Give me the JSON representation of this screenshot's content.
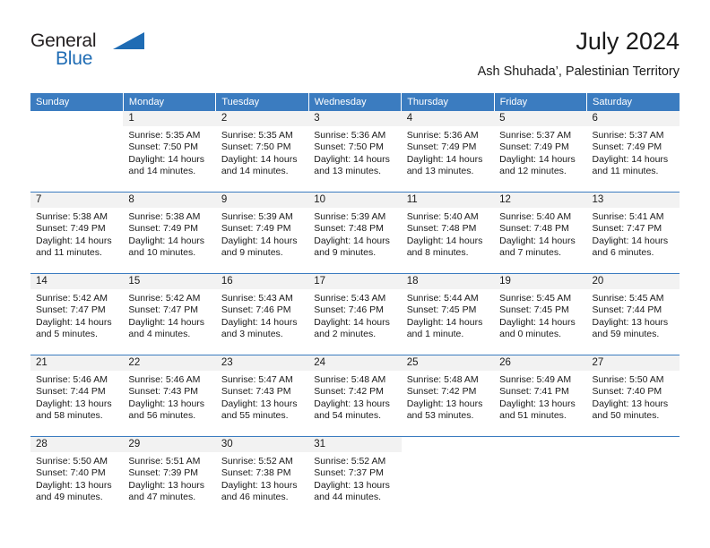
{
  "brand": {
    "name_part1": "General",
    "name_part2": "Blue",
    "triangle_color": "#1f6cb4"
  },
  "header": {
    "title": "July 2024",
    "subtitle": "Ash Shuhada’, Palestinian Territory"
  },
  "theme": {
    "header_blue": "#3b7cc0",
    "daynum_band": "#f2f2f2",
    "text": "#1a1a1a"
  },
  "weekdays": [
    "Sunday",
    "Monday",
    "Tuesday",
    "Wednesday",
    "Thursday",
    "Friday",
    "Saturday"
  ],
  "weeks": [
    [
      {
        "day": "",
        "sunrise": "",
        "sunset": "",
        "daylight1": "",
        "daylight2": "",
        "blank": true
      },
      {
        "day": "1",
        "sunrise": "Sunrise: 5:35 AM",
        "sunset": "Sunset: 7:50 PM",
        "daylight1": "Daylight: 14 hours",
        "daylight2": "and 14 minutes."
      },
      {
        "day": "2",
        "sunrise": "Sunrise: 5:35 AM",
        "sunset": "Sunset: 7:50 PM",
        "daylight1": "Daylight: 14 hours",
        "daylight2": "and 14 minutes."
      },
      {
        "day": "3",
        "sunrise": "Sunrise: 5:36 AM",
        "sunset": "Sunset: 7:50 PM",
        "daylight1": "Daylight: 14 hours",
        "daylight2": "and 13 minutes."
      },
      {
        "day": "4",
        "sunrise": "Sunrise: 5:36 AM",
        "sunset": "Sunset: 7:49 PM",
        "daylight1": "Daylight: 14 hours",
        "daylight2": "and 13 minutes."
      },
      {
        "day": "5",
        "sunrise": "Sunrise: 5:37 AM",
        "sunset": "Sunset: 7:49 PM",
        "daylight1": "Daylight: 14 hours",
        "daylight2": "and 12 minutes."
      },
      {
        "day": "6",
        "sunrise": "Sunrise: 5:37 AM",
        "sunset": "Sunset: 7:49 PM",
        "daylight1": "Daylight: 14 hours",
        "daylight2": "and 11 minutes."
      }
    ],
    [
      {
        "day": "7",
        "sunrise": "Sunrise: 5:38 AM",
        "sunset": "Sunset: 7:49 PM",
        "daylight1": "Daylight: 14 hours",
        "daylight2": "and 11 minutes."
      },
      {
        "day": "8",
        "sunrise": "Sunrise: 5:38 AM",
        "sunset": "Sunset: 7:49 PM",
        "daylight1": "Daylight: 14 hours",
        "daylight2": "and 10 minutes."
      },
      {
        "day": "9",
        "sunrise": "Sunrise: 5:39 AM",
        "sunset": "Sunset: 7:49 PM",
        "daylight1": "Daylight: 14 hours",
        "daylight2": "and 9 minutes."
      },
      {
        "day": "10",
        "sunrise": "Sunrise: 5:39 AM",
        "sunset": "Sunset: 7:48 PM",
        "daylight1": "Daylight: 14 hours",
        "daylight2": "and 9 minutes."
      },
      {
        "day": "11",
        "sunrise": "Sunrise: 5:40 AM",
        "sunset": "Sunset: 7:48 PM",
        "daylight1": "Daylight: 14 hours",
        "daylight2": "and 8 minutes."
      },
      {
        "day": "12",
        "sunrise": "Sunrise: 5:40 AM",
        "sunset": "Sunset: 7:48 PM",
        "daylight1": "Daylight: 14 hours",
        "daylight2": "and 7 minutes."
      },
      {
        "day": "13",
        "sunrise": "Sunrise: 5:41 AM",
        "sunset": "Sunset: 7:47 PM",
        "daylight1": "Daylight: 14 hours",
        "daylight2": "and 6 minutes."
      }
    ],
    [
      {
        "day": "14",
        "sunrise": "Sunrise: 5:42 AM",
        "sunset": "Sunset: 7:47 PM",
        "daylight1": "Daylight: 14 hours",
        "daylight2": "and 5 minutes."
      },
      {
        "day": "15",
        "sunrise": "Sunrise: 5:42 AM",
        "sunset": "Sunset: 7:47 PM",
        "daylight1": "Daylight: 14 hours",
        "daylight2": "and 4 minutes."
      },
      {
        "day": "16",
        "sunrise": "Sunrise: 5:43 AM",
        "sunset": "Sunset: 7:46 PM",
        "daylight1": "Daylight: 14 hours",
        "daylight2": "and 3 minutes."
      },
      {
        "day": "17",
        "sunrise": "Sunrise: 5:43 AM",
        "sunset": "Sunset: 7:46 PM",
        "daylight1": "Daylight: 14 hours",
        "daylight2": "and 2 minutes."
      },
      {
        "day": "18",
        "sunrise": "Sunrise: 5:44 AM",
        "sunset": "Sunset: 7:45 PM",
        "daylight1": "Daylight: 14 hours",
        "daylight2": "and 1 minute."
      },
      {
        "day": "19",
        "sunrise": "Sunrise: 5:45 AM",
        "sunset": "Sunset: 7:45 PM",
        "daylight1": "Daylight: 14 hours",
        "daylight2": "and 0 minutes."
      },
      {
        "day": "20",
        "sunrise": "Sunrise: 5:45 AM",
        "sunset": "Sunset: 7:44 PM",
        "daylight1": "Daylight: 13 hours",
        "daylight2": "and 59 minutes."
      }
    ],
    [
      {
        "day": "21",
        "sunrise": "Sunrise: 5:46 AM",
        "sunset": "Sunset: 7:44 PM",
        "daylight1": "Daylight: 13 hours",
        "daylight2": "and 58 minutes."
      },
      {
        "day": "22",
        "sunrise": "Sunrise: 5:46 AM",
        "sunset": "Sunset: 7:43 PM",
        "daylight1": "Daylight: 13 hours",
        "daylight2": "and 56 minutes."
      },
      {
        "day": "23",
        "sunrise": "Sunrise: 5:47 AM",
        "sunset": "Sunset: 7:43 PM",
        "daylight1": "Daylight: 13 hours",
        "daylight2": "and 55 minutes."
      },
      {
        "day": "24",
        "sunrise": "Sunrise: 5:48 AM",
        "sunset": "Sunset: 7:42 PM",
        "daylight1": "Daylight: 13 hours",
        "daylight2": "and 54 minutes."
      },
      {
        "day": "25",
        "sunrise": "Sunrise: 5:48 AM",
        "sunset": "Sunset: 7:42 PM",
        "daylight1": "Daylight: 13 hours",
        "daylight2": "and 53 minutes."
      },
      {
        "day": "26",
        "sunrise": "Sunrise: 5:49 AM",
        "sunset": "Sunset: 7:41 PM",
        "daylight1": "Daylight: 13 hours",
        "daylight2": "and 51 minutes."
      },
      {
        "day": "27",
        "sunrise": "Sunrise: 5:50 AM",
        "sunset": "Sunset: 7:40 PM",
        "daylight1": "Daylight: 13 hours",
        "daylight2": "and 50 minutes."
      }
    ],
    [
      {
        "day": "28",
        "sunrise": "Sunrise: 5:50 AM",
        "sunset": "Sunset: 7:40 PM",
        "daylight1": "Daylight: 13 hours",
        "daylight2": "and 49 minutes."
      },
      {
        "day": "29",
        "sunrise": "Sunrise: 5:51 AM",
        "sunset": "Sunset: 7:39 PM",
        "daylight1": "Daylight: 13 hours",
        "daylight2": "and 47 minutes."
      },
      {
        "day": "30",
        "sunrise": "Sunrise: 5:52 AM",
        "sunset": "Sunset: 7:38 PM",
        "daylight1": "Daylight: 13 hours",
        "daylight2": "and 46 minutes."
      },
      {
        "day": "31",
        "sunrise": "Sunrise: 5:52 AM",
        "sunset": "Sunset: 7:37 PM",
        "daylight1": "Daylight: 13 hours",
        "daylight2": "and 44 minutes."
      },
      {
        "day": "",
        "sunrise": "",
        "sunset": "",
        "daylight1": "",
        "daylight2": "",
        "blank": true
      },
      {
        "day": "",
        "sunrise": "",
        "sunset": "",
        "daylight1": "",
        "daylight2": "",
        "blank": true
      },
      {
        "day": "",
        "sunrise": "",
        "sunset": "",
        "daylight1": "",
        "daylight2": "",
        "blank": true
      }
    ]
  ]
}
